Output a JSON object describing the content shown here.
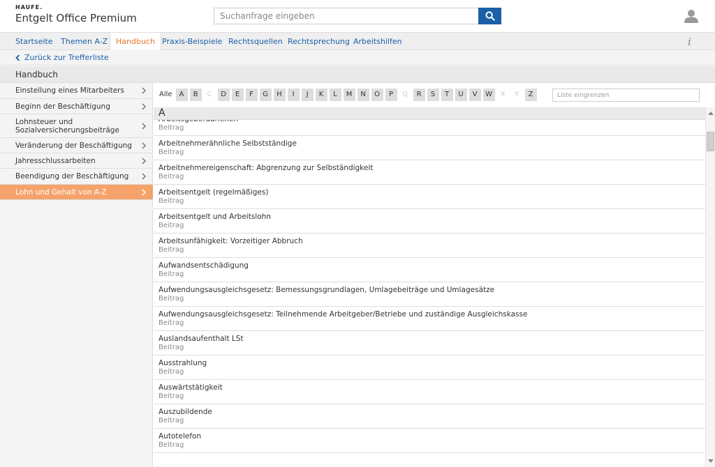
{
  "header": {
    "brand": "HAUFE.",
    "product": "Entgelt Office Premium",
    "search_placeholder": "Suchanfrage eingeben"
  },
  "nav": {
    "items": [
      {
        "label": "Startseite"
      },
      {
        "label": "Themen A-Z"
      },
      {
        "label": "Handbuch",
        "active": true
      },
      {
        "label": "Praxis-Beispiele"
      },
      {
        "label": "Rechtsquellen"
      },
      {
        "label": "Rechtsprechung"
      },
      {
        "label": "Arbeitshilfen"
      }
    ],
    "info_icon": "i"
  },
  "back_link": "Zurück zur Trefferliste",
  "section_title": "Handbuch",
  "sidebar": {
    "items": [
      {
        "label": "Einstellung eines Mitarbeiters"
      },
      {
        "label": "Beginn der Beschäftigung"
      },
      {
        "label": "Lohnsteuer und Sozialversicherungsbeiträge"
      },
      {
        "label": "Veränderung der Beschäftigung"
      },
      {
        "label": "Jahresschlussarbeiten"
      },
      {
        "label": "Beendigung der Beschäftigung"
      },
      {
        "label": "Lohn und Gehalt von A-Z",
        "active": true
      }
    ]
  },
  "alphabet": {
    "all_label": "Alle",
    "letters": [
      "A",
      "B",
      "C",
      "D",
      "E",
      "F",
      "G",
      "H",
      "I",
      "J",
      "K",
      "L",
      "M",
      "N",
      "O",
      "P",
      "Q",
      "R",
      "S",
      "T",
      "U",
      "V",
      "W",
      "X",
      "Y",
      "Z"
    ],
    "disabled": [
      "C",
      "Q",
      "X",
      "Y"
    ]
  },
  "filter_placeholder": "Liste eingrenzen",
  "current_letter": "A",
  "list": {
    "items": [
      {
        "title": "Arbeitsgeberdarlehen",
        "subtitle": "Beitrag"
      },
      {
        "title": "Arbeitnehmerähnliche Selbstständige",
        "subtitle": "Beitrag"
      },
      {
        "title": "Arbeitnehmereigenschaft: Abgrenzung zur Selbständigkeit",
        "subtitle": "Beitrag"
      },
      {
        "title": "Arbeitsentgelt (regelmäßiges)",
        "subtitle": "Beitrag"
      },
      {
        "title": "Arbeitsentgelt und Arbeitslohn",
        "subtitle": "Beitrag"
      },
      {
        "title": "Arbeitsunfähigkeit: Vorzeitiger Abbruch",
        "subtitle": "Beitrag"
      },
      {
        "title": "Aufwandsentschädigung",
        "subtitle": "Beitrag"
      },
      {
        "title": "Aufwendungsausgleichsgesetz: Bemessungsgrundlagen, Umlagebeiträge und Umlagesätze",
        "subtitle": "Beitrag"
      },
      {
        "title": "Aufwendungsausgleichsgesetz: Teilnehmende Arbeitgeber/Betriebe und zuständige Ausgleichskasse",
        "subtitle": "Beitrag"
      },
      {
        "title": "Auslandsaufenthalt LSt",
        "subtitle": "Beitrag"
      },
      {
        "title": "Ausstrahlung",
        "subtitle": "Beitrag"
      },
      {
        "title": "Auswärtstätigkeit",
        "subtitle": "Beitrag"
      },
      {
        "title": "Auszubildende",
        "subtitle": "Beitrag"
      },
      {
        "title": "Autotelefon",
        "subtitle": "Beitrag"
      }
    ]
  },
  "colors": {
    "accent_blue": "#1a5fa8",
    "accent_orange": "#e8772e",
    "active_sidebar": "#f5a36b"
  }
}
